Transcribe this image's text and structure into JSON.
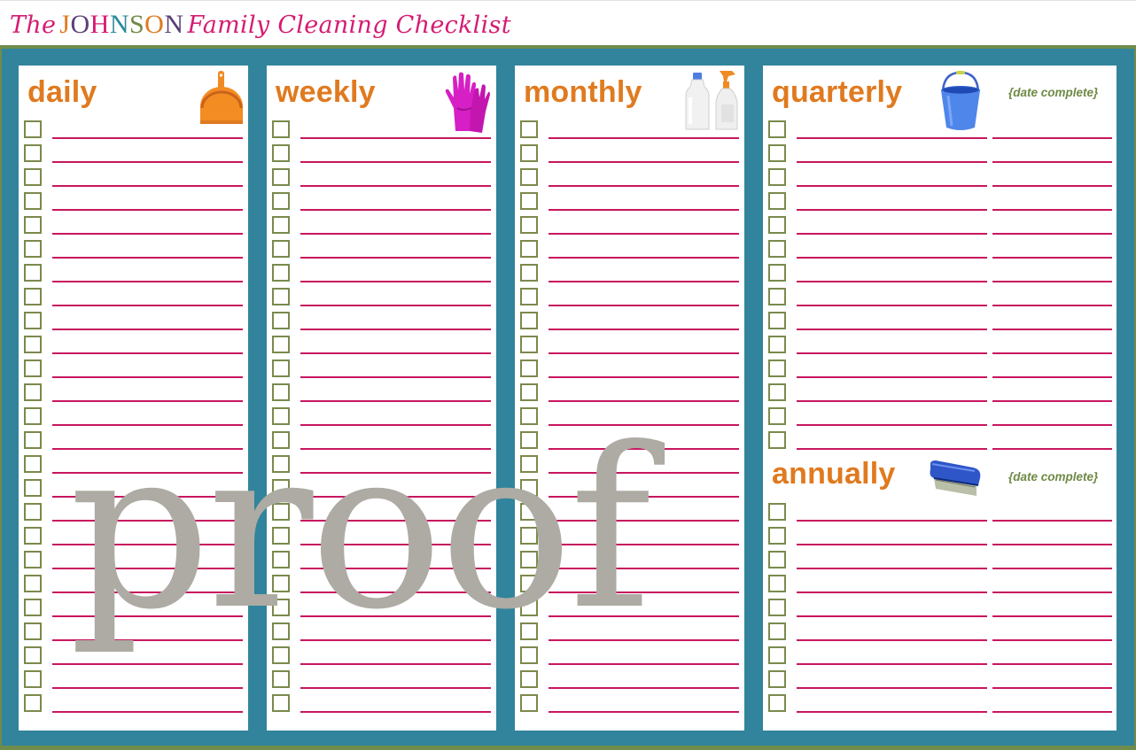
{
  "header": {
    "prefix": "The",
    "family_name_letters": [
      {
        "char": "J",
        "color": "#e07a1f"
      },
      {
        "char": "O",
        "color": "#5a3f78"
      },
      {
        "char": "H",
        "color": "#d51c72"
      },
      {
        "char": "N",
        "color": "#2b8a9c"
      },
      {
        "char": "S",
        "color": "#6f8a45"
      },
      {
        "char": "O",
        "color": "#e07a1f"
      },
      {
        "char": "N",
        "color": "#5a3f78"
      }
    ],
    "suffix": "Family Cleaning Checklist"
  },
  "colors": {
    "heading_orange": "#e07a1f",
    "title_pink": "#d51c72",
    "board_teal": "#31849c",
    "accent_green": "#6e8c4b",
    "checkbox_olive": "#7a8a4d",
    "line_magenta": "#c8165f",
    "watermark_gray": "#adaba3"
  },
  "sections": {
    "daily": {
      "title": "daily",
      "icon": "dustpan-icon",
      "row_count": 25
    },
    "weekly": {
      "title": "weekly",
      "icon": "rubber-gloves-icon",
      "row_count": 25
    },
    "monthly": {
      "title": "monthly",
      "icon": "cleaning-bottles-icon",
      "row_count": 25
    },
    "quarterly": {
      "title": "quarterly",
      "icon": "bucket-icon",
      "date_label": "{date complete}",
      "row_count": 14
    },
    "annually": {
      "title": "annually",
      "icon": "scrub-brush-icon",
      "date_label": "{date complete}",
      "row_count": 9
    }
  },
  "watermark": "proof"
}
